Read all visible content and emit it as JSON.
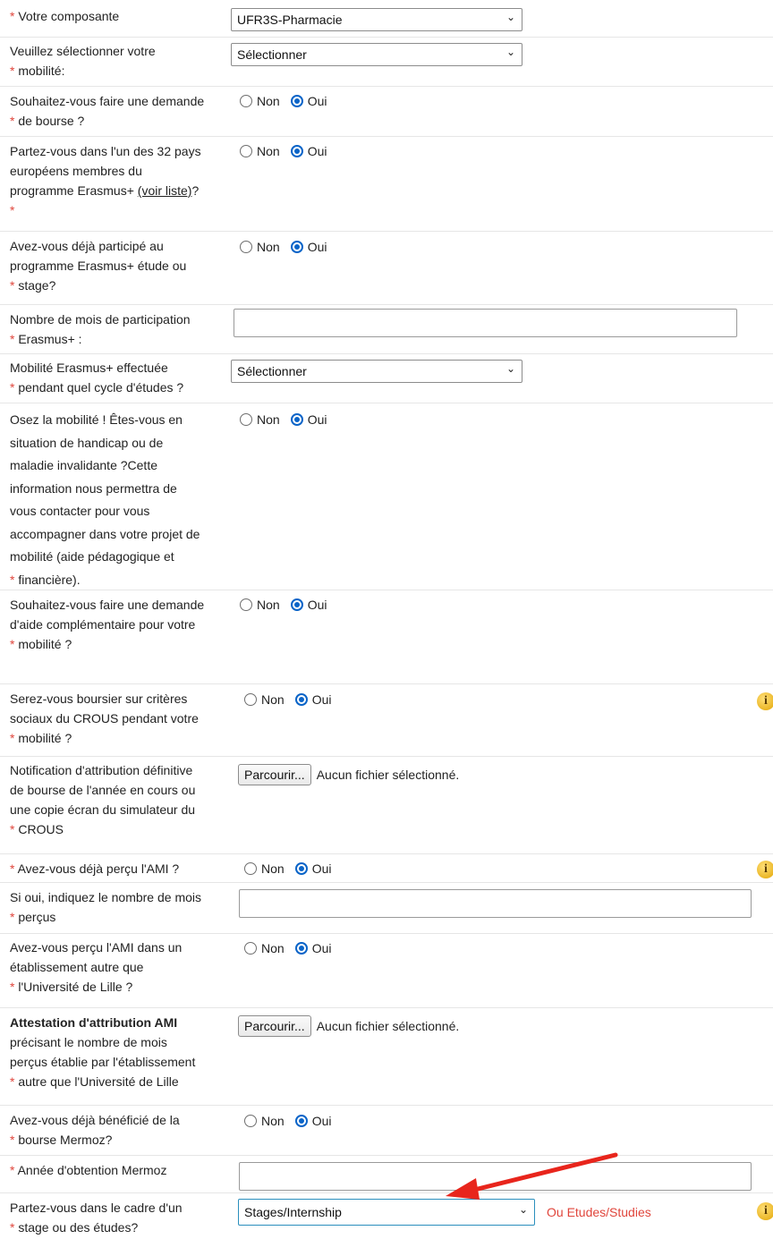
{
  "rows": {
    "composante": {
      "label": "Votre composante",
      "value": "UFR3S-Pharmacie"
    },
    "mobilite": {
      "label_line1": "Veuillez sélectionner votre",
      "label_line2": "mobilité:",
      "value": "Sélectionner"
    },
    "bourse": {
      "label_line1": "Souhaitez-vous faire une demande",
      "label_line2": "de bourse ?"
    },
    "pays": {
      "label_line1": "Partez-vous dans l'un des 32 pays",
      "label_line2": "européens membres du",
      "label_line3_pre": "programme Erasmus+ ",
      "link": "(voir liste)",
      "label_line3_post": "?"
    },
    "participe": {
      "label_line1": "Avez-vous déjà participé au",
      "label_line2": "programme Erasmus+ étude ou",
      "label_line3": "stage?"
    },
    "nbmois": {
      "label_line1": "Nombre de mois de participation",
      "label_line2": "Erasmus+ :",
      "value": ""
    },
    "cycle": {
      "label_line1": "Mobilité Erasmus+ effectuée",
      "label_line2": "pendant quel cycle d'études ?",
      "value": "Sélectionner"
    },
    "handicap": {
      "label_lines": [
        "Osez la mobilité ! Êtes-vous en",
        "situation de handicap ou de",
        "maladie invalidante ?Cette",
        "information nous permettra de",
        "vous contacter pour vous",
        "accompagner dans votre projet de",
        "mobilité (aide pédagogique et"
      ],
      "label_last": "financière)."
    },
    "aide": {
      "label_line1": "Souhaitez-vous faire une demande",
      "label_line2": "d'aide complémentaire pour votre",
      "label_line3": "mobilité ?"
    },
    "crous": {
      "label_line1": "Serez-vous boursier sur critères",
      "label_line2": "sociaux du CROUS pendant votre",
      "label_line3": "mobilité ?"
    },
    "notif": {
      "label_line1": "Notification d'attribution définitive",
      "label_line2": "de bourse de l'année en cours ou",
      "label_line3": "une copie écran du simulateur du",
      "label_line4": "CROUS"
    },
    "ami": {
      "label": "Avez-vous déjà perçu l'AMI ?"
    },
    "amimois": {
      "label_line1": "Si oui, indiquez le nombre de mois",
      "label_line2": "perçus",
      "value": ""
    },
    "amiautre": {
      "label_line1": "Avez-vous perçu l'AMI dans un",
      "label_line2": "établissement autre que",
      "label_line3": "l'Université de Lille ?"
    },
    "attest": {
      "label_bold": "Attestation d'attribution AMI",
      "label_line2": "précisant le nombre de mois",
      "label_line3": "perçus établie par l'établissement",
      "label_line4": "autre que l'Université de Lille"
    },
    "mermoz": {
      "label_line1": "Avez-vous déjà bénéficié de la",
      "label_line2": "bourse Mermoz?"
    },
    "annee": {
      "label": "Année d'obtention Mermoz",
      "value": ""
    },
    "cadre": {
      "label_line1": "Partez-vous dans le cadre d'un",
      "label_line2": "stage ou des études?",
      "value": "Stages/Internship",
      "hint": "Ou Etudes/Studies"
    }
  },
  "common": {
    "required_mark": "*",
    "radio_no": "Non",
    "radio_yes": "Oui",
    "file_button": "Parcourir...",
    "file_none": "Aucun fichier sélectionné.",
    "info_glyph": "i",
    "chevron": "⌄"
  },
  "colors": {
    "required": "#e0453b",
    "arrow": "#e8251c",
    "radio_checked": "#0a64c8",
    "info": "#e2a400"
  }
}
